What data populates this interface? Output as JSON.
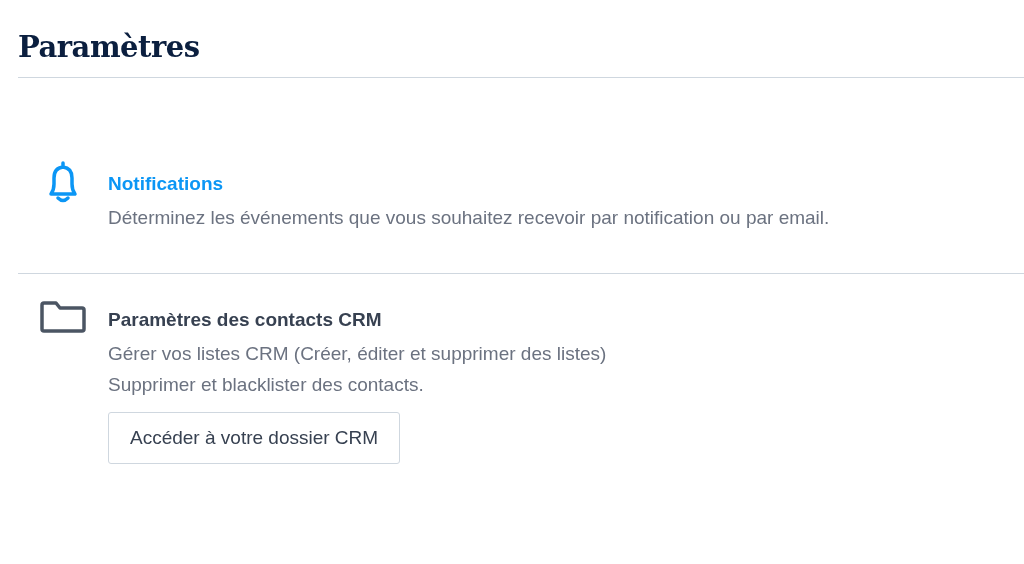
{
  "page": {
    "title": "Paramètres"
  },
  "sections": [
    {
      "kind": "alerts",
      "title": "Notifications",
      "selected": true,
      "description": [
        "Déterminez les événements que vous souhaitez recevoir par notification ou par email."
      ]
    },
    {
      "kind": "storage",
      "title": "Paramètres des contacts CRM",
      "selected": false,
      "description": [
        "Gérer vos listes CRM (Créer, éditer et supprimer des listes)",
        "Supprimer et blacklister des contacts."
      ],
      "button": "Accéder à votre dossier CRM"
    }
  ]
}
